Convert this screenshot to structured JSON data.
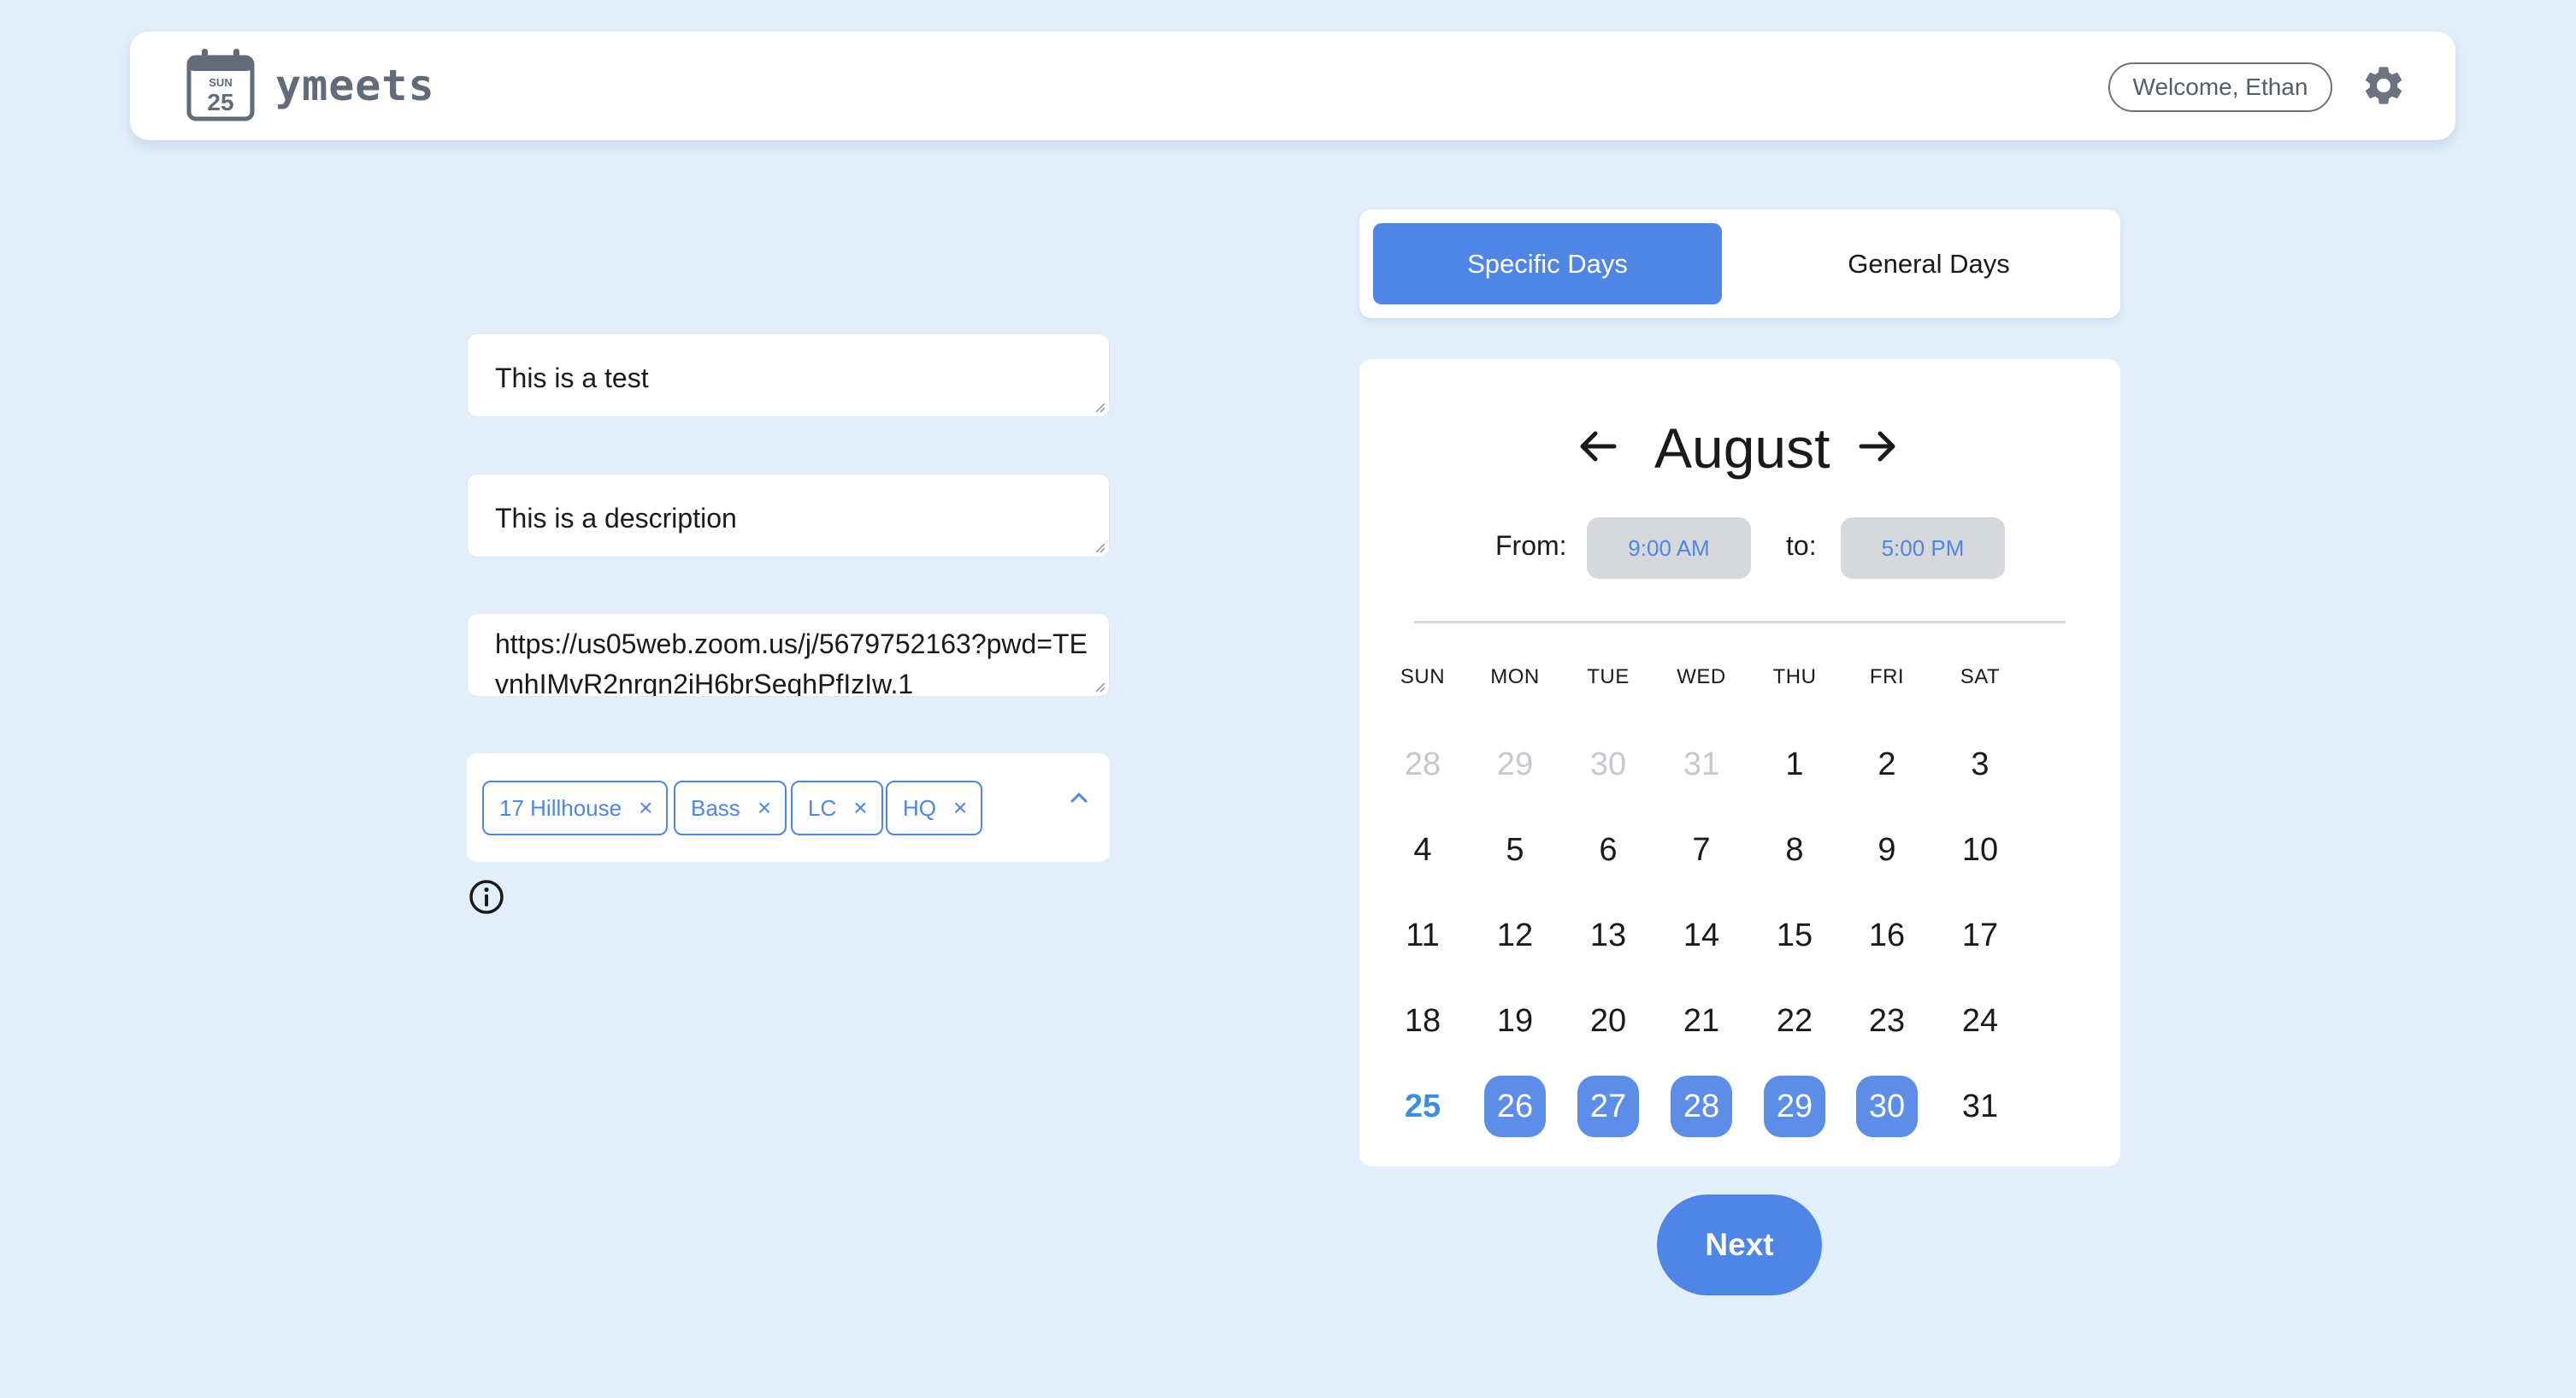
{
  "header": {
    "logo_day_abbr": "SUN",
    "logo_day_num": "25",
    "app_name": "ymeets",
    "welcome": "Welcome, Ethan"
  },
  "form": {
    "title_value": "This is a test",
    "description_value": "This is a description",
    "link_value": "https://us05web.zoom.us/j/5679752163?pwd=TEvnhIMvR2nrqn2iH6brSeqhPfIzIw.1",
    "locations": [
      {
        "label": "17 Hillhouse",
        "remove": "×"
      },
      {
        "label": "Bass",
        "remove": "×"
      },
      {
        "label": "LC",
        "remove": "×"
      },
      {
        "label": "HQ",
        "remove": "×"
      }
    ]
  },
  "tabs": {
    "specific": "Specific Days",
    "general": "General Days",
    "active": "specific"
  },
  "calendar": {
    "month": "August",
    "from_label": "From:",
    "from_value": "9:00 AM",
    "to_label": "to:",
    "to_value": "5:00 PM",
    "weekdays": [
      "SUN",
      "MON",
      "TUE",
      "WED",
      "THU",
      "FRI",
      "SAT"
    ],
    "weeks": [
      [
        {
          "d": "28",
          "s": "muted"
        },
        {
          "d": "29",
          "s": "muted"
        },
        {
          "d": "30",
          "s": "muted"
        },
        {
          "d": "31",
          "s": "muted"
        },
        {
          "d": "1",
          "s": ""
        },
        {
          "d": "2",
          "s": ""
        },
        {
          "d": "3",
          "s": ""
        }
      ],
      [
        {
          "d": "4",
          "s": ""
        },
        {
          "d": "5",
          "s": ""
        },
        {
          "d": "6",
          "s": ""
        },
        {
          "d": "7",
          "s": ""
        },
        {
          "d": "8",
          "s": ""
        },
        {
          "d": "9",
          "s": ""
        },
        {
          "d": "10",
          "s": ""
        }
      ],
      [
        {
          "d": "11",
          "s": ""
        },
        {
          "d": "12",
          "s": ""
        },
        {
          "d": "13",
          "s": ""
        },
        {
          "d": "14",
          "s": ""
        },
        {
          "d": "15",
          "s": ""
        },
        {
          "d": "16",
          "s": ""
        },
        {
          "d": "17",
          "s": ""
        }
      ],
      [
        {
          "d": "18",
          "s": ""
        },
        {
          "d": "19",
          "s": ""
        },
        {
          "d": "20",
          "s": ""
        },
        {
          "d": "21",
          "s": ""
        },
        {
          "d": "22",
          "s": ""
        },
        {
          "d": "23",
          "s": ""
        },
        {
          "d": "24",
          "s": ""
        }
      ],
      [
        {
          "d": "25",
          "s": "today"
        },
        {
          "d": "26",
          "s": "selected"
        },
        {
          "d": "27",
          "s": "selected"
        },
        {
          "d": "28",
          "s": "selected"
        },
        {
          "d": "29",
          "s": "selected"
        },
        {
          "d": "30",
          "s": "selected"
        },
        {
          "d": "31",
          "s": ""
        }
      ]
    ]
  },
  "actions": {
    "next": "Next"
  },
  "colors": {
    "background": "#e2eefa",
    "accent": "#4f86e6",
    "selected_day": "#5c8ee8",
    "today": "#3a8fe3"
  },
  "icons": {
    "logo": "calendar-icon",
    "settings": "gear-icon",
    "info": "info-icon",
    "collapse": "chevron-up-icon",
    "prev_month": "arrow-left-icon",
    "next_month": "arrow-right-icon"
  }
}
